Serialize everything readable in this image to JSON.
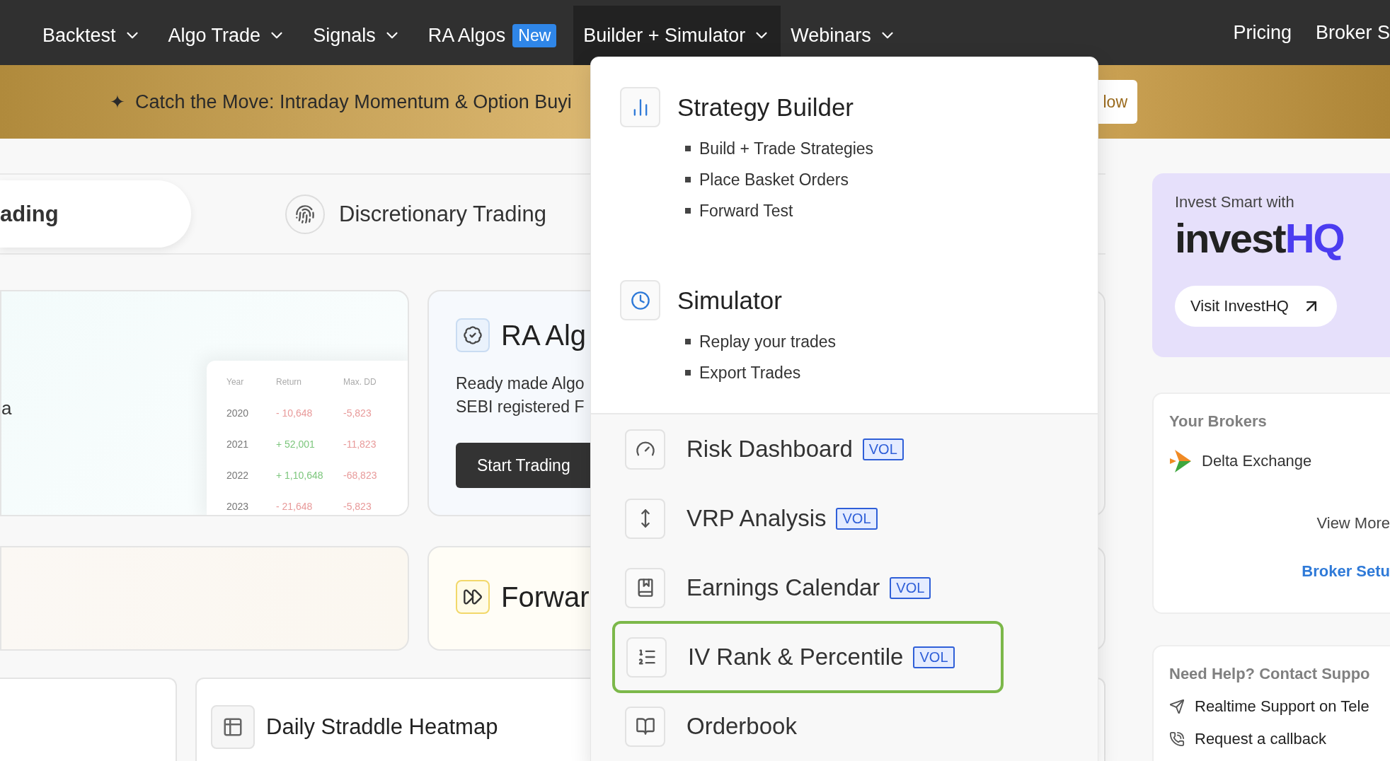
{
  "nav": {
    "items": [
      {
        "label": "Backtest",
        "selected": false
      },
      {
        "label": "Algo Trade",
        "selected": false
      },
      {
        "label": "Signals",
        "selected": false
      },
      {
        "label": "RA Algos",
        "badge": "New",
        "selected": false
      },
      {
        "label": "Builder + Simulator",
        "selected": true
      },
      {
        "label": "Webinars",
        "selected": false
      }
    ],
    "right_links": [
      "Pricing",
      "Broker S"
    ]
  },
  "banner": {
    "mark": "✦",
    "text": "Catch the Move: Intraday Momentum & Option Buyi",
    "button": "low"
  },
  "tabs": [
    {
      "label": "ading",
      "selected": true
    },
    {
      "label": "Discretionary Trading",
      "selected": false
    }
  ],
  "backtest_card": {
    "text": "a",
    "table": {
      "columns": [
        "Year",
        "Return",
        "Max. DD"
      ],
      "rows": [
        {
          "year": "2020",
          "return": "- 10,648",
          "color": "#e89a9a",
          "max_dd": "-5,823"
        },
        {
          "year": "2021",
          "return": "+ 52,001",
          "color": "#7cc67c",
          "max_dd": "-11,823"
        },
        {
          "year": "2022",
          "return": "+ 1,10,648",
          "color": "#7cc67c",
          "max_dd": "-68,823"
        },
        {
          "year": "2023",
          "return": "- 21,648",
          "color": "#e89a9a",
          "max_dd": "-5,823"
        }
      ]
    }
  },
  "ra_algos_card": {
    "title": "RA Alg",
    "description": [
      "Ready made Algo",
      "SEBI registered F"
    ],
    "button": "Start Trading"
  },
  "forward_card": {
    "title": "Forwar"
  },
  "heatmap_card": {
    "title": "Daily Straddle Heatmap"
  },
  "dropdown": {
    "sections": [
      {
        "title": "Strategy Builder",
        "bullets": [
          "Build + Trade Strategies",
          "Place Basket Orders",
          "Forward Test"
        ]
      },
      {
        "title": "Simulator",
        "bullets": [
          "Replay your trades",
          "Export Trades"
        ]
      }
    ],
    "items": [
      {
        "label": "Risk Dashboard",
        "badge": "VOL",
        "highlighted": false
      },
      {
        "label": "VRP Analysis",
        "badge": "VOL",
        "highlighted": false
      },
      {
        "label": "Earnings Calendar",
        "badge": "VOL",
        "highlighted": false
      },
      {
        "label": "IV Rank & Percentile",
        "badge": "VOL",
        "highlighted": true
      },
      {
        "label": "Orderbook",
        "highlighted": false
      }
    ]
  },
  "sidebar": {
    "promo": {
      "eyebrow": "Invest Smart with",
      "logo_dark": "invest",
      "logo_accent": "HQ",
      "button": "Visit InvestHQ"
    },
    "brokers": {
      "title": "Your Brokers",
      "items": [
        "Delta Exchange"
      ],
      "view_more": "View More",
      "setup_link": "Broker Setu"
    },
    "help": {
      "title": "Need Help? Contact Suppo",
      "items": [
        "Realtime Support on Tele",
        "Request a callback"
      ]
    }
  }
}
